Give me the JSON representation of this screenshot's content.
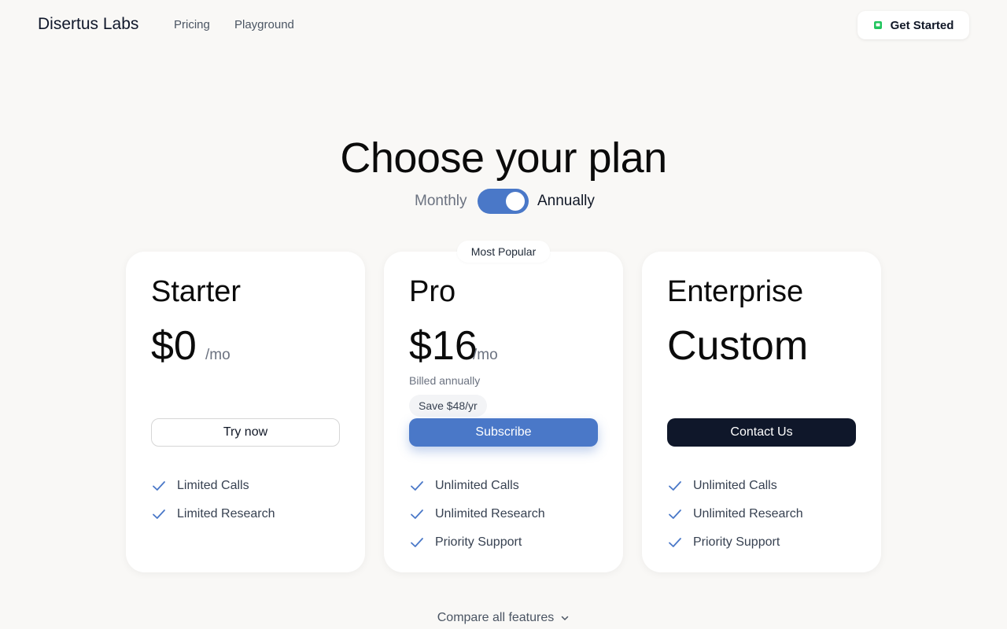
{
  "header": {
    "brand": "Disertus Labs",
    "nav": {
      "pricing": "Pricing",
      "playground": "Playground"
    },
    "cta_label": "Get Started",
    "cta_icon": "green-square-icon",
    "cta_icon_color": "#22c55e"
  },
  "hero": {
    "title": "Choose your plan",
    "billing": {
      "monthly": "Monthly",
      "annually": "Annually",
      "selected": "Annually"
    }
  },
  "colors": {
    "accent": "#4a78c8",
    "dark": "#0f172a",
    "check": "#4a78c8"
  },
  "plans": {
    "starter": {
      "name": "Starter",
      "price": "$0",
      "unit": "/mo",
      "button": "Try now",
      "features": [
        "Limited Calls",
        "Limited Research"
      ]
    },
    "pro": {
      "badge": "Most Popular",
      "name": "Pro",
      "price": "$16",
      "unit": "/mo",
      "billed": "Billed annually",
      "save": "Save $48/yr",
      "button": "Subscribe",
      "features": [
        "Unlimited Calls",
        "Unlimited Research",
        "Priority Support"
      ]
    },
    "enterprise": {
      "name": "Enterprise",
      "price": "Custom",
      "button": "Contact Us",
      "features": [
        "Unlimited Calls",
        "Unlimited Research",
        "Priority Support"
      ]
    }
  },
  "footer": {
    "compare": "Compare all features",
    "compare_icon": "chevron-down-icon"
  }
}
